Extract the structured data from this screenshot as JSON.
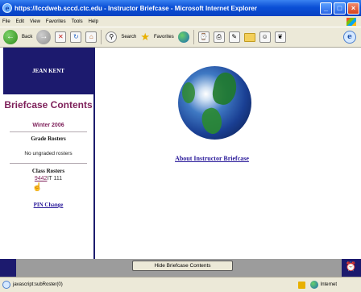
{
  "window": {
    "title": "https://lccdweb.sccd.ctc.edu - Instructor Briefcase - Microsoft Internet Explorer"
  },
  "menu": [
    "File",
    "Edit",
    "View",
    "Favorites",
    "Tools",
    "Help"
  ],
  "toolbar": {
    "back_label": "Back",
    "search_label": "Search",
    "favorites_label": "Favorites"
  },
  "sidebar": {
    "user_name": "JEAN KENT",
    "title": "Briefcase Contents",
    "term": "Winter 2006",
    "grade_rosters_heading": "Grade Rosters",
    "grade_rosters_message": "No ungraded rosters",
    "class_rosters_heading": "Class Rosters",
    "class_roster_link": "9442",
    "class_roster_course": "IT 111",
    "pin_change_label": "PIN Change"
  },
  "main": {
    "about_link": "About Instructor Briefcase"
  },
  "bottom": {
    "hide_button_label": "Hide Briefcase Contents"
  },
  "status": {
    "text": "javascript:subRoster(0)",
    "zone": "Internet"
  }
}
